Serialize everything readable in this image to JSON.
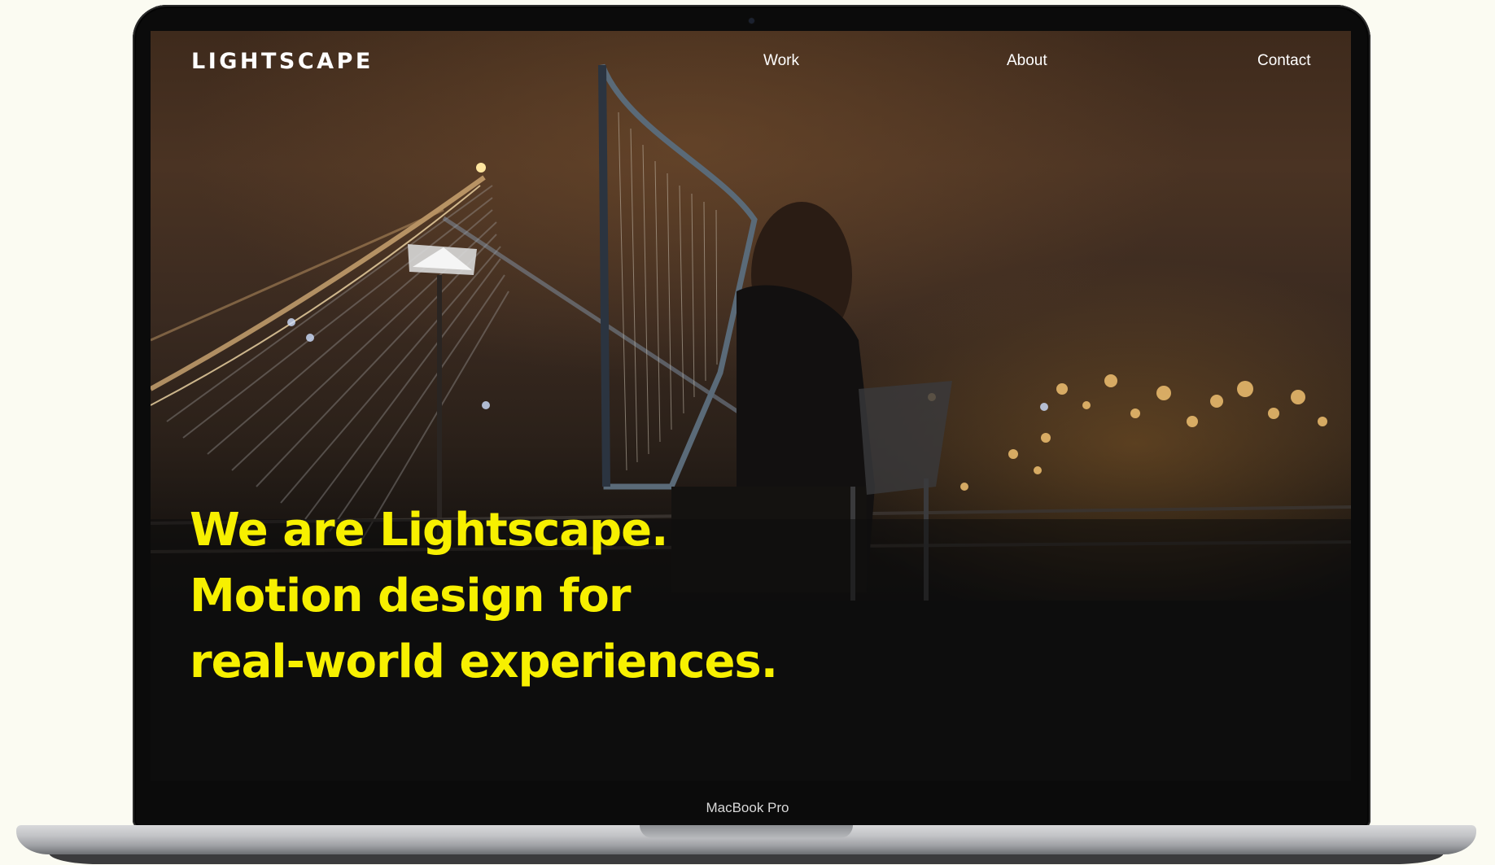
{
  "device": {
    "model_label": "MacBook Pro"
  },
  "site": {
    "logo": "LIGHTSCAPE",
    "nav": {
      "work": "Work",
      "about": "About",
      "contact": "Contact"
    },
    "hero": {
      "line1": "We are Lightscape.",
      "line2": "Motion design for",
      "line3": "real-world experiences."
    }
  },
  "colors": {
    "accent": "#f7f000",
    "page_background": "#fbfbf2",
    "screen_background": "#0d0d0d",
    "nav_text": "#ffffff"
  }
}
